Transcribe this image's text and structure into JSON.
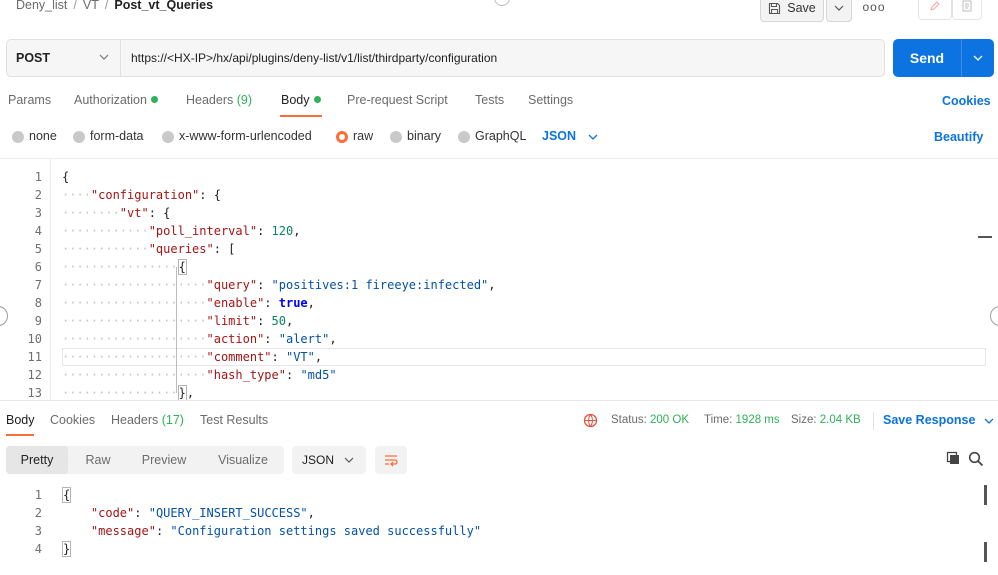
{
  "breadcrumb": {
    "parts": [
      "Deny_list",
      "VT"
    ],
    "current": "Post_vt_Queries"
  },
  "toolbar": {
    "save_label": "Save",
    "more_label": "ooo"
  },
  "request": {
    "method": "POST",
    "url": "https://<HX-IP>/hx/api/plugins/deny-list/v1/list/thirdparty/configuration",
    "send_label": "Send"
  },
  "request_tabs": {
    "params": "Params",
    "authorization": "Authorization",
    "headers": "Headers",
    "headers_count": "(9)",
    "body": "Body",
    "prerequest": "Pre-request Script",
    "tests": "Tests",
    "settings": "Settings",
    "cookies": "Cookies"
  },
  "body_types": {
    "none": "none",
    "form_data": "form-data",
    "urlencoded": "x-www-form-urlencoded",
    "raw": "raw",
    "binary": "binary",
    "graphql": "GraphQL",
    "format": "JSON",
    "beautify": "Beautify"
  },
  "request_lines": [
    "1",
    "2",
    "3",
    "4",
    "5",
    "6",
    "7",
    "8",
    "9",
    "10",
    "11",
    "12",
    "13"
  ],
  "request_code": {
    "open_brace": "{",
    "configuration_key": "\"configuration\"",
    "vt_key": "\"vt\"",
    "poll_interval_key": "\"poll_interval\"",
    "poll_interval_val": "120",
    "queries_key": "\"queries\"",
    "query_key": "\"query\"",
    "query_val": "\"positives:1 fireeye:infected\"",
    "enable_key": "\"enable\"",
    "enable_val": "true",
    "limit_key": "\"limit\"",
    "limit_val": "50",
    "action_key": "\"action\"",
    "action_val": "\"alert\"",
    "comment_key": "\"comment\"",
    "comment_val": "\"VT\"",
    "hash_type_key": "\"hash_type\"",
    "hash_type_val": "\"md5\""
  },
  "response_tabs": {
    "body": "Body",
    "cookies": "Cookies",
    "headers": "Headers",
    "headers_count": "(17)",
    "test_results": "Test Results"
  },
  "response_status": {
    "status_label": "Status:",
    "status_value": "200 OK",
    "time_label": "Time:",
    "time_value": "1928 ms",
    "size_label": "Size:",
    "size_value": "2.04 KB",
    "save_response": "Save Response"
  },
  "response_view": {
    "pretty": "Pretty",
    "raw": "Raw",
    "preview": "Preview",
    "visualize": "Visualize",
    "format": "JSON"
  },
  "response_lines": [
    "1",
    "2",
    "3",
    "4"
  ],
  "response_code": {
    "code_key": "\"code\"",
    "code_val": "\"QUERY_INSERT_SUCCESS\"",
    "message_key": "\"message\"",
    "message_val": "\"Configuration settings saved successfully\""
  },
  "colors": {
    "accent": "#0c73e0",
    "active_tab": "#ff6c37",
    "success": "#2eb15a"
  }
}
